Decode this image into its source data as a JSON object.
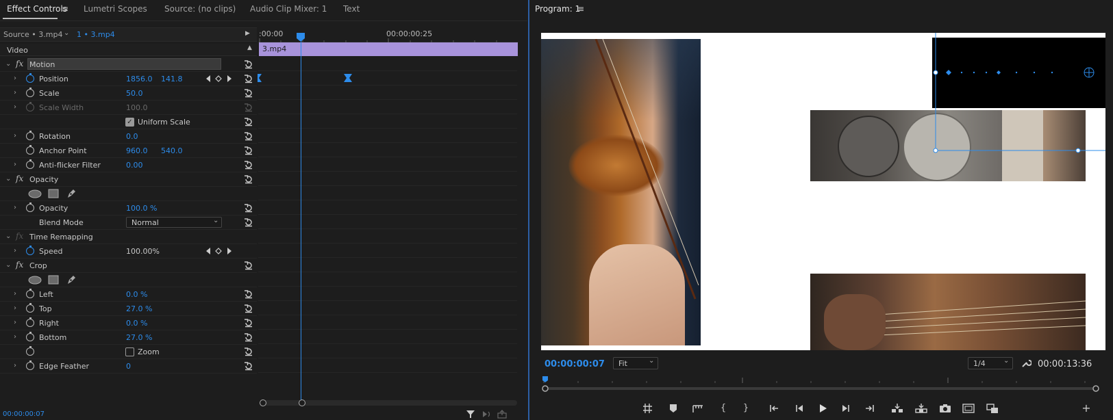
{
  "tabs": [
    {
      "label": "Effect Controls",
      "active": true
    },
    {
      "label": "Lumetri Scopes"
    },
    {
      "label": "Source: (no clips)"
    },
    {
      "label": "Audio Clip Mixer: 1"
    },
    {
      "label": "Text"
    }
  ],
  "source_bar": {
    "source": "Source • 3.mp4",
    "sequence": "1 • 3.mp4"
  },
  "timeline": {
    "start_tc": ":00:00",
    "mark_tc": "00:00:00:25",
    "clip_label": "3.mp4",
    "current_tc": "00:00:00:07"
  },
  "video_header": "Video",
  "effects": {
    "motion": {
      "label": "Motion",
      "position": {
        "label": "Position",
        "x": "1856.0",
        "y": "141.8"
      },
      "scale": {
        "label": "Scale",
        "value": "50.0"
      },
      "scale_width": {
        "label": "Scale Width",
        "value": "100.0"
      },
      "uniform_scale": {
        "label": "Uniform Scale",
        "checked": true
      },
      "rotation": {
        "label": "Rotation",
        "value": "0.0"
      },
      "anchor": {
        "label": "Anchor Point",
        "x": "960.0",
        "y": "540.0"
      },
      "antiflicker": {
        "label": "Anti-flicker Filter",
        "value": "0.00"
      }
    },
    "opacity": {
      "label": "Opacity",
      "opacity": {
        "label": "Opacity",
        "value": "100.0 %"
      },
      "blend": {
        "label": "Blend Mode",
        "value": "Normal"
      }
    },
    "time_remap": {
      "label": "Time Remapping",
      "speed": {
        "label": "Speed",
        "value": "100.00%"
      }
    },
    "crop": {
      "label": "Crop",
      "left": {
        "label": "Left",
        "value": "0.0 %"
      },
      "top": {
        "label": "Top",
        "value": "27.0 %"
      },
      "right": {
        "label": "Right",
        "value": "0.0 %"
      },
      "bottom": {
        "label": "Bottom",
        "value": "27.0 %"
      },
      "zoom": {
        "label": "Zoom",
        "checked": false
      },
      "edge_feather": {
        "label": "Edge Feather",
        "value": "0"
      }
    }
  },
  "program": {
    "title": "Program: 1",
    "current_tc": "00:00:00:07",
    "fit": "Fit",
    "resolution": "1/4",
    "duration_tc": "00:00:13:36"
  },
  "colors": {
    "accent": "#2d8ceb",
    "clip": "#a893db",
    "panel_bg": "#1d1d1d"
  }
}
